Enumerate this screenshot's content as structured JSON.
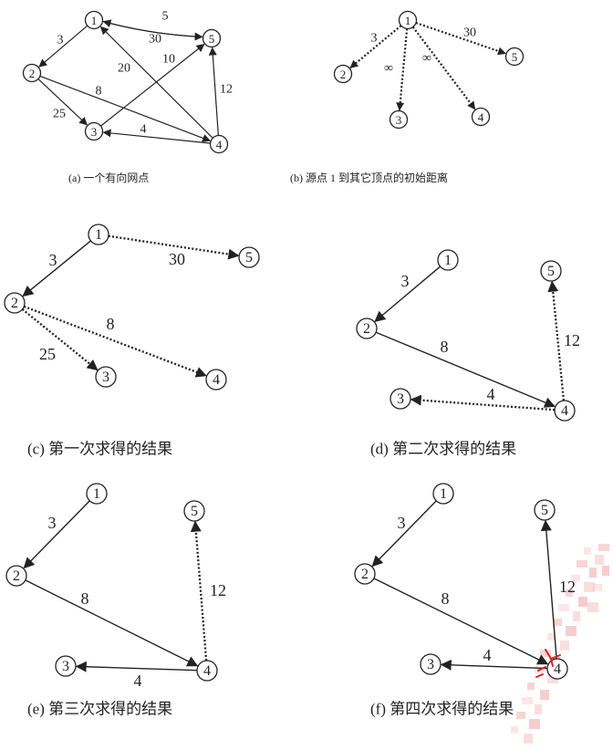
{
  "panels": [
    {
      "id": "a",
      "caption": "(a)  一个有向网点",
      "nodes": [
        "1",
        "2",
        "3",
        "4",
        "5"
      ],
      "edges": [
        {
          "from": "1",
          "to": "2",
          "weight": "3",
          "style": "solid"
        },
        {
          "from": "5",
          "to": "1",
          "weight": "5",
          "style": "solid"
        },
        {
          "from": "1",
          "to": "5",
          "weight": "30",
          "style": "solid"
        },
        {
          "from": "4",
          "to": "1",
          "weight": "20",
          "style": "solid"
        },
        {
          "from": "3",
          "to": "5",
          "weight": "10",
          "style": "solid"
        },
        {
          "from": "4",
          "to": "5",
          "weight": "12",
          "style": "solid"
        },
        {
          "from": "2",
          "to": "4",
          "weight": "8",
          "style": "solid"
        },
        {
          "from": "2",
          "to": "3",
          "weight": "25",
          "style": "solid"
        },
        {
          "from": "4",
          "to": "3",
          "weight": "4",
          "style": "solid"
        }
      ]
    },
    {
      "id": "b",
      "caption": "(b)   源点 1 到其它顶点的初始距离",
      "nodes": [
        "1",
        "2",
        "3",
        "4",
        "5"
      ],
      "edges": [
        {
          "from": "1",
          "to": "2",
          "weight": "3",
          "style": "dotted"
        },
        {
          "from": "1",
          "to": "3",
          "weight": "∞",
          "style": "dotted"
        },
        {
          "from": "1",
          "to": "4",
          "weight": "∞",
          "style": "dotted"
        },
        {
          "from": "1",
          "to": "5",
          "weight": "30",
          "style": "dotted"
        }
      ]
    },
    {
      "id": "c",
      "caption": "(c)  第一次求得的结果",
      "nodes": [
        "1",
        "2",
        "3",
        "4",
        "5"
      ],
      "edges": [
        {
          "from": "1",
          "to": "2",
          "weight": "3",
          "style": "solid"
        },
        {
          "from": "1",
          "to": "5",
          "weight": "30",
          "style": "dotted"
        },
        {
          "from": "2",
          "to": "4",
          "weight": "8",
          "style": "dotted"
        },
        {
          "from": "2",
          "to": "3",
          "weight": "25",
          "style": "dotted"
        }
      ]
    },
    {
      "id": "d",
      "caption": "(d)   第二次求得的结果",
      "nodes": [
        "1",
        "2",
        "3",
        "4",
        "5"
      ],
      "edges": [
        {
          "from": "1",
          "to": "2",
          "weight": "3",
          "style": "solid"
        },
        {
          "from": "2",
          "to": "4",
          "weight": "8",
          "style": "solid"
        },
        {
          "from": "4",
          "to": "5",
          "weight": "12",
          "style": "dotted"
        },
        {
          "from": "4",
          "to": "3",
          "weight": "4",
          "style": "dotted"
        }
      ]
    },
    {
      "id": "e",
      "caption": "(e)  第三次求得的结果",
      "nodes": [
        "1",
        "2",
        "3",
        "4",
        "5"
      ],
      "edges": [
        {
          "from": "1",
          "to": "2",
          "weight": "3",
          "style": "solid"
        },
        {
          "from": "2",
          "to": "4",
          "weight": "8",
          "style": "solid"
        },
        {
          "from": "4",
          "to": "3",
          "weight": "4",
          "style": "solid"
        },
        {
          "from": "4",
          "to": "5",
          "weight": "12",
          "style": "dotted"
        }
      ]
    },
    {
      "id": "f",
      "caption": "(f)   第四次求得的结果",
      "nodes": [
        "1",
        "2",
        "3",
        "4",
        "5"
      ],
      "edges": [
        {
          "from": "1",
          "to": "2",
          "weight": "3",
          "style": "solid"
        },
        {
          "from": "2",
          "to": "4",
          "weight": "8",
          "style": "solid"
        },
        {
          "from": "4",
          "to": "3",
          "weight": "4",
          "style": "solid"
        },
        {
          "from": "4",
          "to": "5",
          "weight": "12",
          "style": "solid"
        }
      ]
    }
  ],
  "colors": {
    "ink": "#222222",
    "highlight": "#e02020",
    "watermark": "#f2b8b8"
  }
}
